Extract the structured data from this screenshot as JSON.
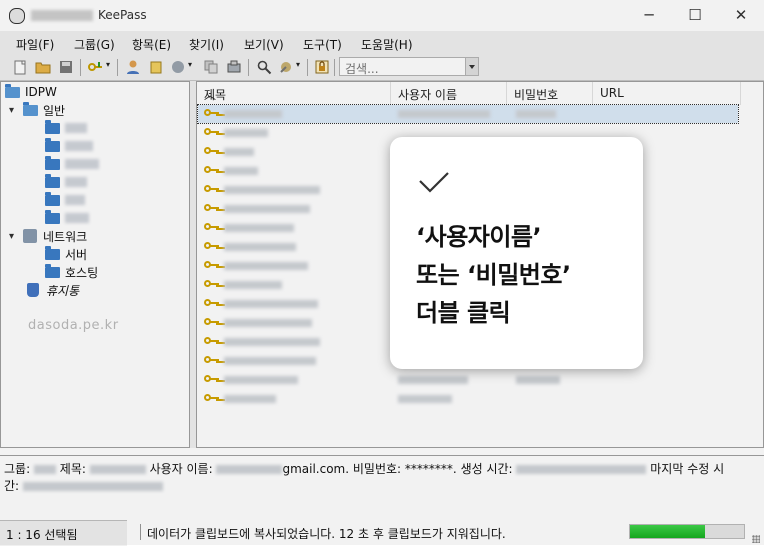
{
  "window": {
    "title": "KeePass",
    "minimize": "─",
    "maximize": "☐",
    "close": "✕"
  },
  "menu": [
    "파일(F)",
    "그룹(G)",
    "항목(E)",
    "찾기(I)",
    "보기(V)",
    "도구(T)",
    "도움말(H)"
  ],
  "toolbar": {
    "search_placeholder": "검색...",
    "icons": [
      "new-db-icon",
      "open-folder-icon",
      "save-icon",
      "add-entry-icon",
      "user-icon",
      "copy-password-icon",
      "globe-icon",
      "copy-icon",
      "sync-icon",
      "find-icon",
      "tools-icon",
      "lock-icon"
    ]
  },
  "tree": {
    "root": "IDPW",
    "groups": [
      {
        "label": "일반",
        "children": 6
      },
      {
        "label": "네트워크",
        "children": [
          "서버",
          "호스팅"
        ]
      }
    ],
    "recycle_bin": "휴지통",
    "watermark": "dasoda.pe.kr"
  },
  "list": {
    "columns": [
      "제목",
      "사용자 이름",
      "비밀번호",
      "URL"
    ],
    "row_count": 16,
    "selected_row": 0
  },
  "overlay": {
    "lines": [
      "‘사용자이름’",
      "또는 ‘비밀번호’",
      "더블 클릭"
    ]
  },
  "details": {
    "group_label": "그룹:",
    "title_label": "제목:",
    "user_label": "사용자 이름:",
    "user_suffix": "gmail.com.",
    "password_label": "비밀번호:",
    "password_value": "********.",
    "created_label": "생성 시간:",
    "modified_label": "마지막 수정 시",
    "line2_label": "간:"
  },
  "status": {
    "count": "1 : 16 선택됨",
    "message": "데이터가 클립보드에 복사되었습니다. 12 초 후 클립보드가 지워집니다.",
    "progress": 0.66
  },
  "colors": {
    "accent": "#3c7ec9",
    "progress": "#16b020"
  }
}
